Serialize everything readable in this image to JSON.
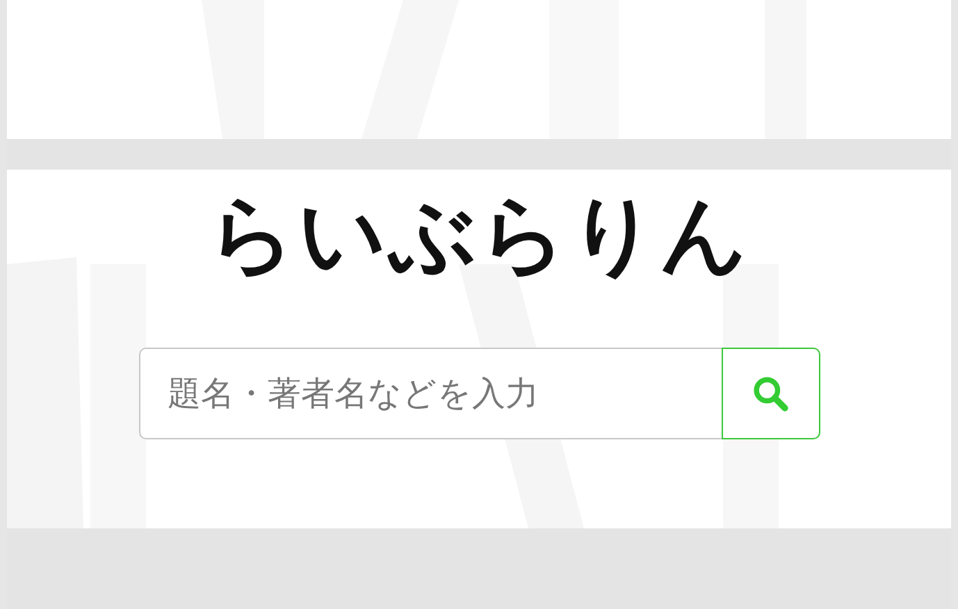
{
  "title": "らいぶらりん",
  "search": {
    "placeholder": "題名・著者名などを入力"
  }
}
